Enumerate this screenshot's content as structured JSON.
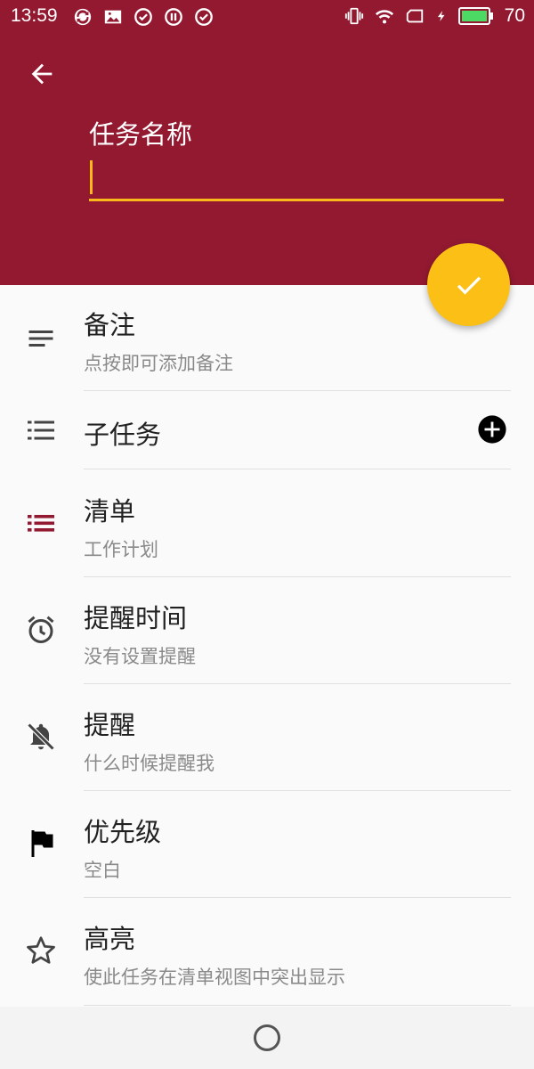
{
  "status_bar": {
    "time": "13:59",
    "battery_level": "70"
  },
  "header": {
    "task_name_label": "任务名称",
    "task_name_value": "",
    "background_color": "#931931",
    "accent_color": "#fbbf15"
  },
  "fields": {
    "notes": {
      "title": "备注",
      "subtitle": "点按即可添加备注"
    },
    "subtasks": {
      "title": "子任务"
    },
    "list": {
      "title": "清单",
      "subtitle": "工作计划"
    },
    "reminder_time": {
      "title": "提醒时间",
      "subtitle": "没有设置提醒"
    },
    "reminder": {
      "title": "提醒",
      "subtitle": "什么时候提醒我"
    },
    "priority": {
      "title": "优先级",
      "subtitle": "空白"
    },
    "highlight": {
      "title": "高亮",
      "subtitle": "使此任务在清单视图中突出显示"
    }
  },
  "icons": {
    "back": "arrow-back-icon",
    "confirm": "check-icon",
    "notes": "notes-icon",
    "subtasks": "checklist-icon",
    "list": "list-icon",
    "reminder_time": "alarm-icon",
    "reminder": "bell-off-icon",
    "priority": "flag-icon",
    "highlight": "star-outline-icon",
    "add_subtask": "add-circle-icon"
  }
}
